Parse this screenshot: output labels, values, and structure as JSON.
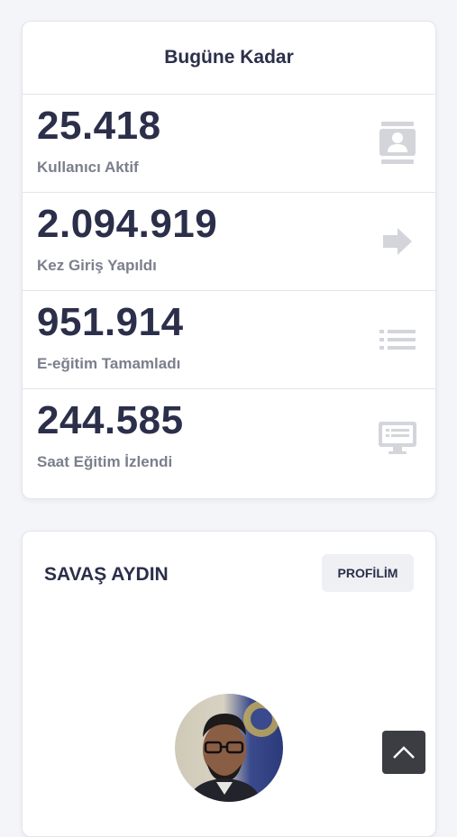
{
  "stats": {
    "title": "Bugüne Kadar",
    "items": [
      {
        "value": "25.418",
        "label": "Kullanıcı Aktif",
        "icon": "contact-card-icon"
      },
      {
        "value": "2.094.919",
        "label": "Kez Giriş Yapıldı",
        "icon": "arrow-right-icon"
      },
      {
        "value": "951.914",
        "label": "E-eğitim Tamamladı",
        "icon": "list-icon"
      },
      {
        "value": "244.585",
        "label": "Saat Eğitim İzlendi",
        "icon": "monitor-icon"
      }
    ]
  },
  "profile": {
    "name": "SAVAŞ AYDIN",
    "button_label": "PROFİLİM"
  },
  "colors": {
    "text_dark": "#2b2f4a",
    "text_muted": "#7b7f8c",
    "icon_gray": "#d3d5db",
    "background": "#f4f5f9"
  }
}
